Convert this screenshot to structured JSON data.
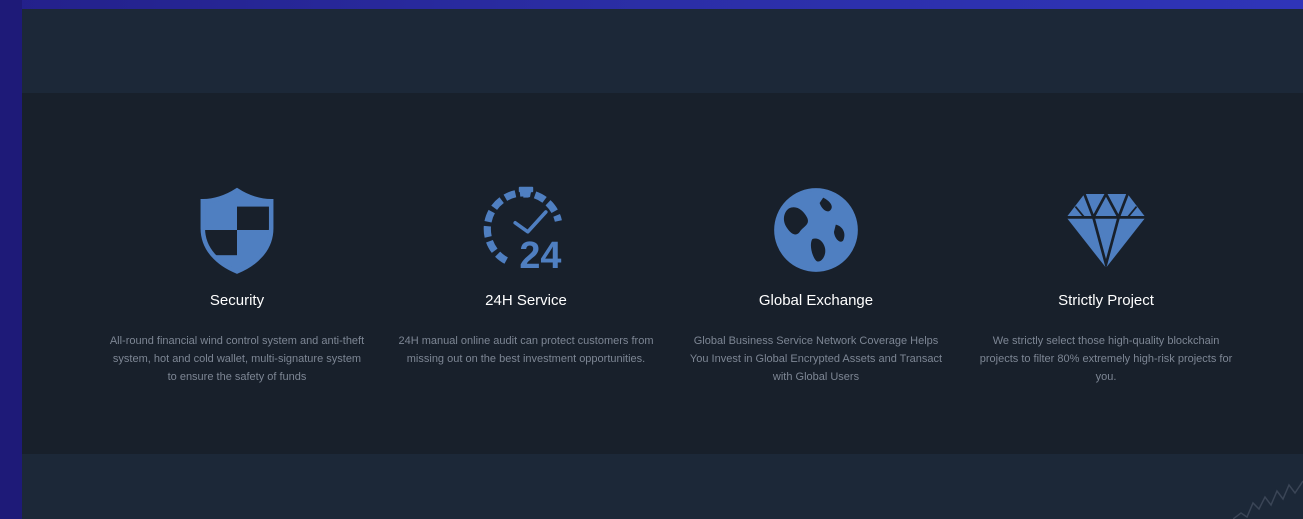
{
  "colors": {
    "icon": "#4f7fc1",
    "title": "#ffffff",
    "description": "#7d8694",
    "features_bg": "#18202b",
    "band_bg": "#1c2838"
  },
  "features": [
    {
      "icon": "shield-icon",
      "title": "Security",
      "description": "All-round financial wind control system and anti-theft system, hot and cold wallet, multi-signature system to ensure the safety of funds"
    },
    {
      "icon": "clock-24-icon",
      "title": "24H Service",
      "description": "24H manual online audit can protect customers from missing out on the best investment opportunities."
    },
    {
      "icon": "globe-icon",
      "title": "Global Exchange",
      "description": "Global Business Service Network Coverage Helps You Invest in Global Encrypted Assets and Transact with Global Users"
    },
    {
      "icon": "diamond-icon",
      "title": "Strictly Project",
      "description": "We strictly select those high-quality blockchain projects to filter 80% extremely high-risk projects for you."
    }
  ]
}
